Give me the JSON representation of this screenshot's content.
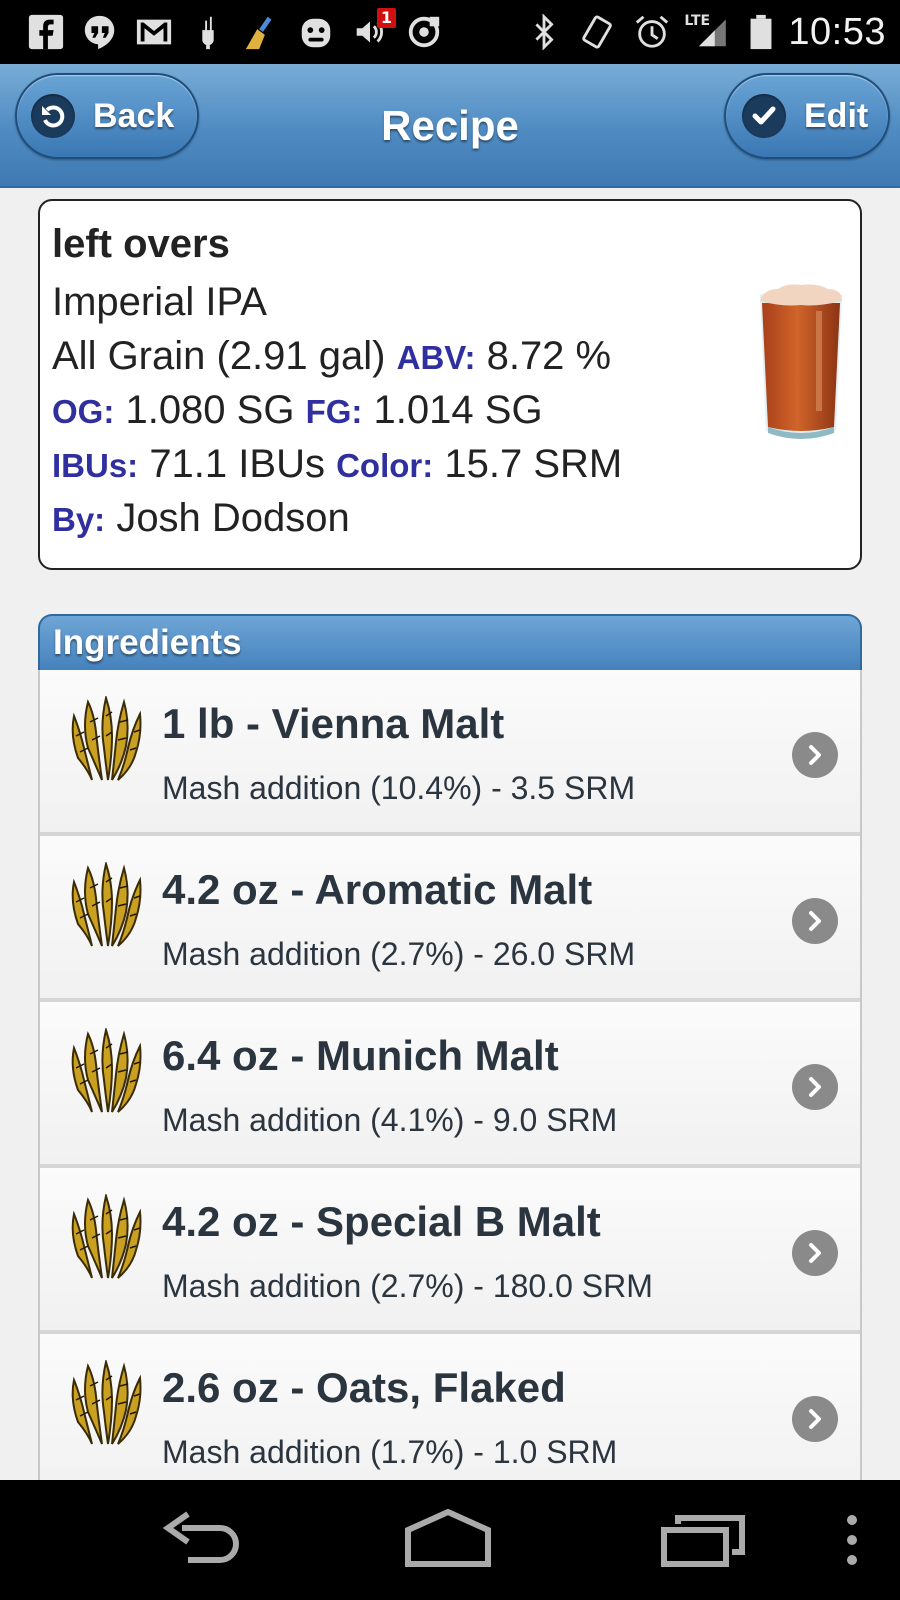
{
  "status_bar": {
    "notification_icons": [
      "facebook-icon",
      "hangouts-icon",
      "gmail-icon",
      "usb-debug-icon",
      "cleaner-broom-icon",
      "app-face-icon",
      "sound-alert-icon",
      "sync-icon"
    ],
    "sound_badge": "1",
    "system_icons": [
      "bluetooth-icon",
      "vibrate-icon",
      "alarm-icon",
      "lte-signal-icon",
      "battery-icon"
    ],
    "network_label": "LTE",
    "time": "10:53"
  },
  "header": {
    "title": "Recipe",
    "back_label": "Back",
    "edit_label": "Edit",
    "colors": {
      "bar": "#4f8bc2",
      "button_dark": "#1b3b5c"
    }
  },
  "recipe": {
    "name": "left overs",
    "style": "Imperial IPA",
    "type_batch": "All Grain (2.91 gal)",
    "abv_label": "ABV:",
    "abv_value": "8.72 %",
    "og_label": "OG:",
    "og_value": "1.080 SG",
    "fg_label": "FG:",
    "fg_value": "1.014 SG",
    "ibu_label": "IBUs:",
    "ibu_value": "71.1 IBUs",
    "color_label": "Color:",
    "color_value": "15.7 SRM",
    "by_label": "By:",
    "by_value": "Josh Dodson",
    "label_color": "#2f2fa0",
    "beer_color": "#c2501e"
  },
  "ingredients": {
    "title": "Ingredients",
    "items": [
      {
        "title": "1 lb - Vienna Malt",
        "sub": "Mash addition (10.4%) - 3.5 SRM"
      },
      {
        "title": "4.2 oz - Aromatic Malt",
        "sub": "Mash addition (2.7%) - 26.0 SRM"
      },
      {
        "title": "6.4 oz - Munich Malt",
        "sub": "Mash addition (4.1%) - 9.0 SRM"
      },
      {
        "title": "4.2 oz - Special B Malt",
        "sub": "Mash addition (2.7%) - 180.0 SRM"
      },
      {
        "title": "2.6 oz - Oats, Flaked",
        "sub": "Mash addition (1.7%) - 1.0 SRM"
      }
    ]
  },
  "nav_bar": {
    "buttons": [
      "back-nav-icon",
      "home-nav-icon",
      "recents-nav-icon",
      "overflow-menu-icon"
    ]
  }
}
